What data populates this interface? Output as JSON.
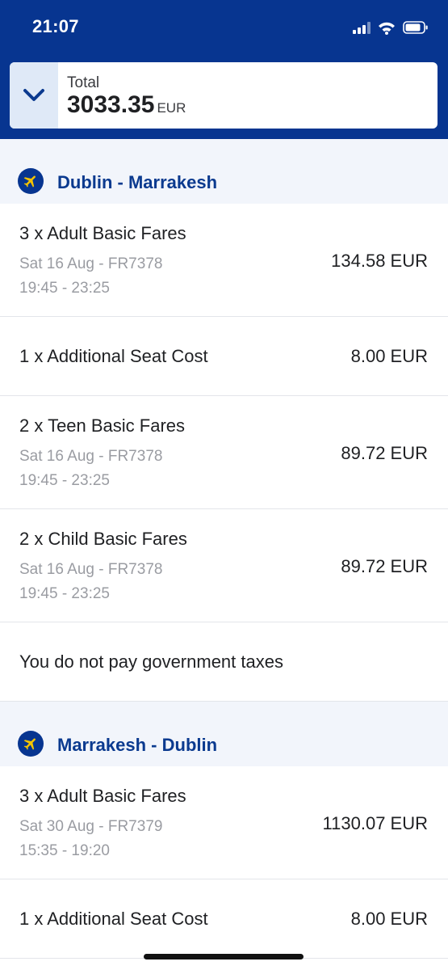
{
  "status_bar": {
    "time": "21:07"
  },
  "summary": {
    "label": "Total",
    "amount": "3033.35",
    "currency": "EUR"
  },
  "routes": [
    {
      "title": "Dublin - Marrakesh",
      "rows": [
        {
          "title": "3 x Adult Basic Fares",
          "date_flight": "Sat 16 Aug - FR7378",
          "time": "19:45 - 23:25",
          "price": "134.58 EUR"
        },
        {
          "title": "1 x Additional Seat Cost",
          "price": "8.00 EUR"
        },
        {
          "title": "2 x Teen Basic Fares",
          "date_flight": "Sat 16 Aug - FR7378",
          "time": "19:45 - 23:25",
          "price": "89.72 EUR"
        },
        {
          "title": "2 x Child Basic Fares",
          "date_flight": "Sat 16 Aug - FR7378",
          "time": "19:45 - 23:25",
          "price": "89.72 EUR"
        },
        {
          "title": "You do not pay government taxes"
        }
      ]
    },
    {
      "title": "Marrakesh - Dublin",
      "rows": [
        {
          "title": "3 x Adult Basic Fares",
          "date_flight": "Sat 30 Aug - FR7379",
          "time": "15:35 - 19:20",
          "price": "1130.07 EUR"
        },
        {
          "title": "1 x Additional Seat Cost",
          "price": "8.00 EUR"
        }
      ]
    }
  ],
  "icons": {
    "expand": "chevron-down-icon",
    "route": "airplane-icon",
    "signal": "cellular-signal-icon",
    "wifi": "wifi-icon",
    "battery": "battery-icon"
  },
  "colors": {
    "brand": "#073590",
    "route_text": "#0b3a8f",
    "section_bg": "#f2f5fb",
    "expand_bg": "#dfe9f7"
  }
}
